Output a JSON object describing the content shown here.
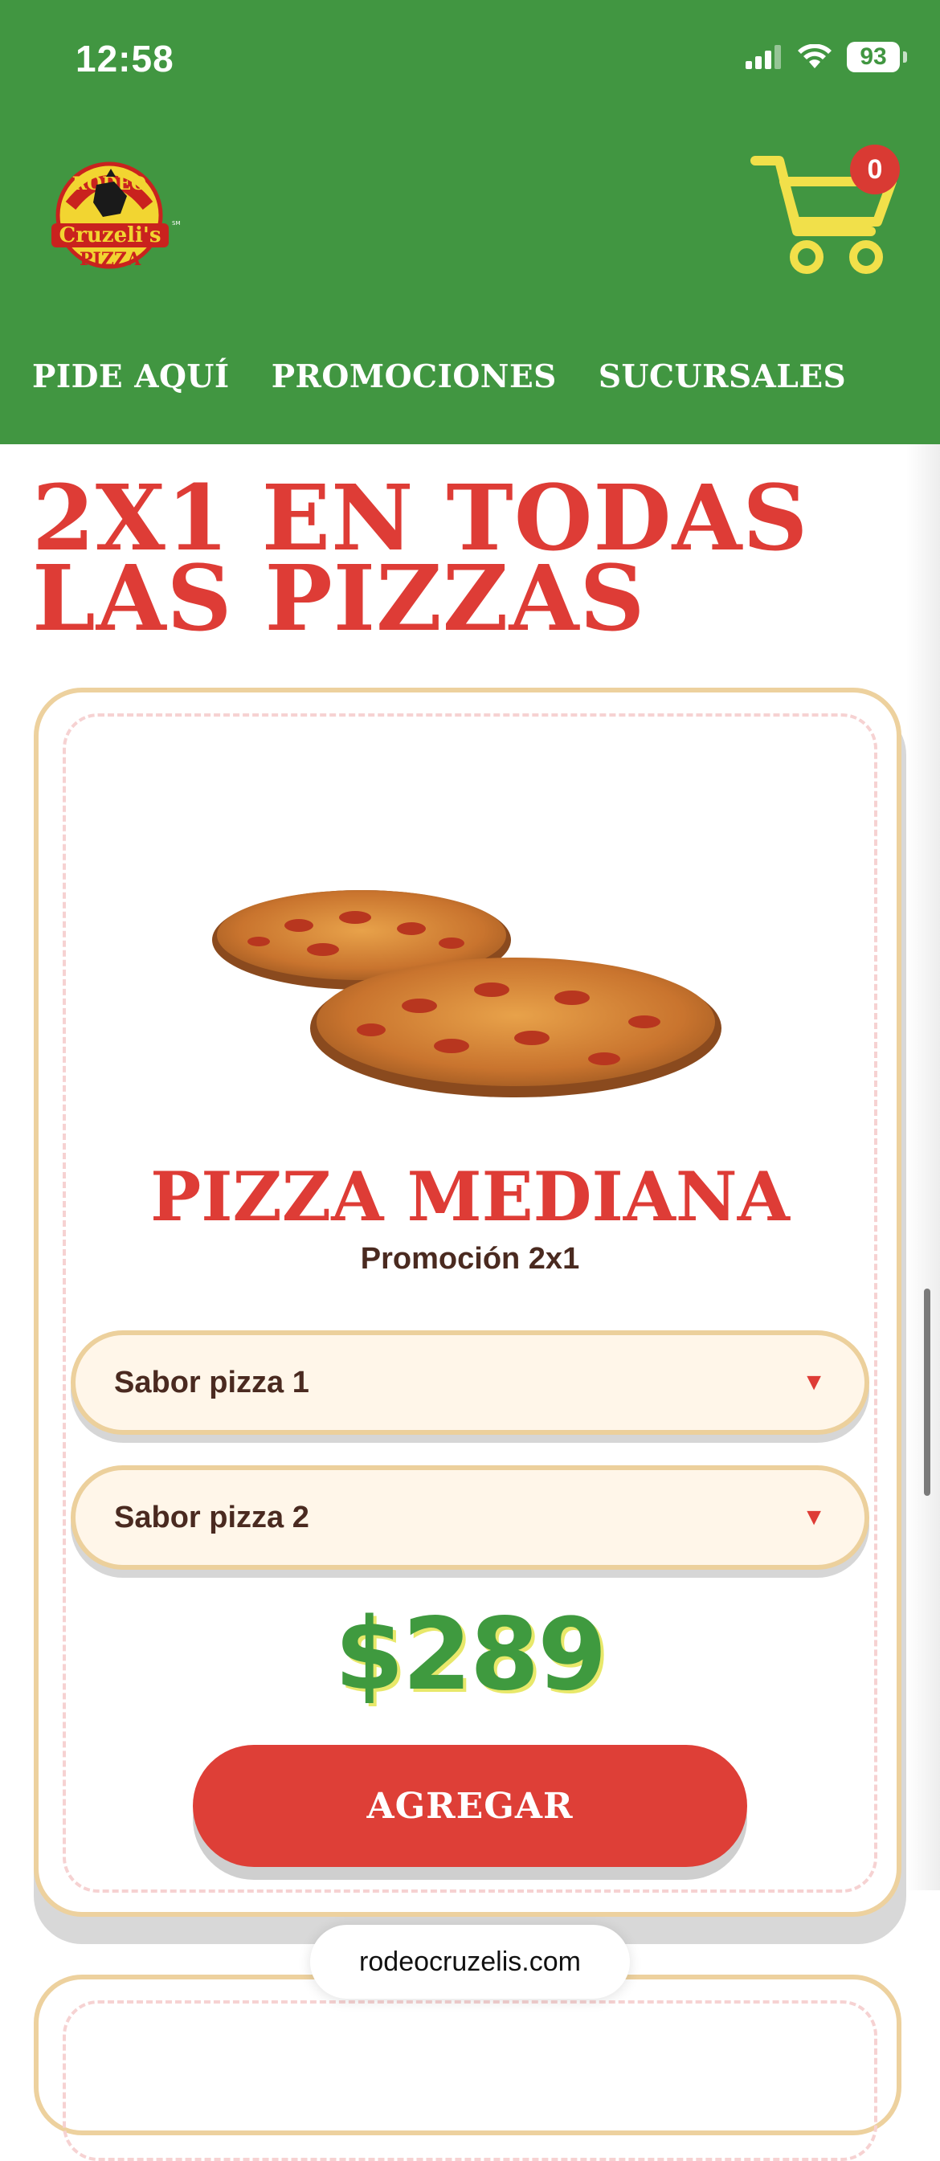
{
  "status_bar": {
    "time": "12:58",
    "battery": "93"
  },
  "header": {
    "logo_alt": "Rodeo Cruzeli's Pizza",
    "cart_count": "0",
    "nav": [
      "PIDE AQUÍ",
      "PROMOCIONES",
      "SUCURSALES"
    ]
  },
  "promo": {
    "title_line1": "2X1 EN TODAS",
    "title_line2": "LAS PIZZAS"
  },
  "product": {
    "name": "PIZZA MEDIANA",
    "subtitle": "Promoción 2x1",
    "flavor1_label": "Sabor pizza 1",
    "flavor2_label": "Sabor pizza 2",
    "price": "$289",
    "add_label": "AGREGAR"
  },
  "browser": {
    "url": "rodeocruzelis.com"
  },
  "colors": {
    "header_green": "#419641",
    "brand_red": "#de3c36",
    "price_green": "#3f9a3f",
    "cart_yellow": "#f1e04a",
    "card_border": "#edd19e"
  }
}
